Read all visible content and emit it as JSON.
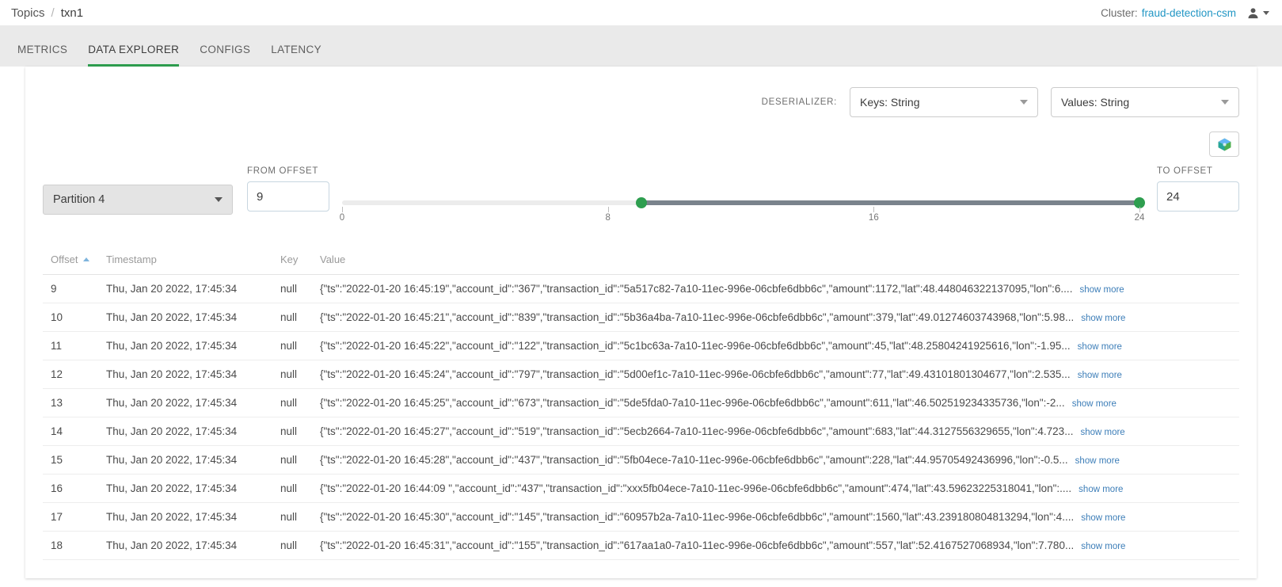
{
  "topbar": {
    "breadcrumb": {
      "root": "Topics",
      "separator": "/",
      "current": "txn1"
    },
    "cluster_label": "Cluster:",
    "cluster_name": "fraud-detection-csm",
    "user_icon": "user-avatar-icon"
  },
  "tabs": [
    {
      "label": "METRICS",
      "active": false
    },
    {
      "label": "DATA EXPLORER",
      "active": true
    },
    {
      "label": "CONFIGS",
      "active": false
    },
    {
      "label": "LATENCY",
      "active": false
    }
  ],
  "deserializer": {
    "label": "DESERIALIZER:",
    "keys": "Keys: String",
    "values": "Values: String"
  },
  "toolbar": {
    "cube_icon": "kafka-cube-icon"
  },
  "controls": {
    "partition": "Partition 4",
    "from_offset_label": "FROM OFFSET",
    "from_offset_value": "9",
    "to_offset_label": "TO OFFSET",
    "to_offset_value": "24",
    "slider": {
      "min": 0,
      "max": 24,
      "from": 9,
      "to": 24,
      "ticks": [
        {
          "value": 0,
          "label": "0"
        },
        {
          "value": 8,
          "label": "8"
        },
        {
          "value": 16,
          "label": "16"
        },
        {
          "value": 24,
          "label": "24"
        }
      ],
      "track_color": "#7a838c",
      "thumb_color": "#2e9e4f"
    }
  },
  "table": {
    "headers": {
      "offset": "Offset",
      "timestamp": "Timestamp",
      "key": "Key",
      "value": "Value"
    },
    "sort": {
      "column": "Offset",
      "direction": "asc"
    },
    "show_more_label": "show more",
    "rows": [
      {
        "offset": "9",
        "timestamp": "Thu, Jan 20 2022, 17:45:34",
        "key": "null",
        "value": "{\"ts\":\"2022-01-20 16:45:19\",\"account_id\":\"367\",\"transaction_id\":\"5a517c82-7a10-11ec-996e-06cbfe6dbb6c\",\"amount\":1172,\"lat\":48.448046322137095,\"lon\":6...."
      },
      {
        "offset": "10",
        "timestamp": "Thu, Jan 20 2022, 17:45:34",
        "key": "null",
        "value": "{\"ts\":\"2022-01-20 16:45:21\",\"account_id\":\"839\",\"transaction_id\":\"5b36a4ba-7a10-11ec-996e-06cbfe6dbb6c\",\"amount\":379,\"lat\":49.01274603743968,\"lon\":5.98..."
      },
      {
        "offset": "11",
        "timestamp": "Thu, Jan 20 2022, 17:45:34",
        "key": "null",
        "value": "{\"ts\":\"2022-01-20 16:45:22\",\"account_id\":\"122\",\"transaction_id\":\"5c1bc63a-7a10-11ec-996e-06cbfe6dbb6c\",\"amount\":45,\"lat\":48.25804241925616,\"lon\":-1.95..."
      },
      {
        "offset": "12",
        "timestamp": "Thu, Jan 20 2022, 17:45:34",
        "key": "null",
        "value": "{\"ts\":\"2022-01-20 16:45:24\",\"account_id\":\"797\",\"transaction_id\":\"5d00ef1c-7a10-11ec-996e-06cbfe6dbb6c\",\"amount\":77,\"lat\":49.43101801304677,\"lon\":2.535..."
      },
      {
        "offset": "13",
        "timestamp": "Thu, Jan 20 2022, 17:45:34",
        "key": "null",
        "value": "{\"ts\":\"2022-01-20 16:45:25\",\"account_id\":\"673\",\"transaction_id\":\"5de5fda0-7a10-11ec-996e-06cbfe6dbb6c\",\"amount\":611,\"lat\":46.502519234335736,\"lon\":-2..."
      },
      {
        "offset": "14",
        "timestamp": "Thu, Jan 20 2022, 17:45:34",
        "key": "null",
        "value": "{\"ts\":\"2022-01-20 16:45:27\",\"account_id\":\"519\",\"transaction_id\":\"5ecb2664-7a10-11ec-996e-06cbfe6dbb6c\",\"amount\":683,\"lat\":44.3127556329655,\"lon\":4.723..."
      },
      {
        "offset": "15",
        "timestamp": "Thu, Jan 20 2022, 17:45:34",
        "key": "null",
        "value": "{\"ts\":\"2022-01-20 16:45:28\",\"account_id\":\"437\",\"transaction_id\":\"5fb04ece-7a10-11ec-996e-06cbfe6dbb6c\",\"amount\":228,\"lat\":44.95705492436996,\"lon\":-0.5..."
      },
      {
        "offset": "16",
        "timestamp": "Thu, Jan 20 2022, 17:45:34",
        "key": "null",
        "value": "{\"ts\":\"2022-01-20 16:44:09 \",\"account_id\":\"437\",\"transaction_id\":\"xxx5fb04ece-7a10-11ec-996e-06cbfe6dbb6c\",\"amount\":474,\"lat\":43.59623225318041,\"lon\":...."
      },
      {
        "offset": "17",
        "timestamp": "Thu, Jan 20 2022, 17:45:34",
        "key": "null",
        "value": "{\"ts\":\"2022-01-20 16:45:30\",\"account_id\":\"145\",\"transaction_id\":\"60957b2a-7a10-11ec-996e-06cbfe6dbb6c\",\"amount\":1560,\"lat\":43.239180804813294,\"lon\":4...."
      },
      {
        "offset": "18",
        "timestamp": "Thu, Jan 20 2022, 17:45:34",
        "key": "null",
        "value": "{\"ts\":\"2022-01-20 16:45:31\",\"account_id\":\"155\",\"transaction_id\":\"617aa1a0-7a10-11ec-996e-06cbfe6dbb6c\",\"amount\":557,\"lat\":52.4167527068934,\"lon\":7.780..."
      }
    ]
  }
}
